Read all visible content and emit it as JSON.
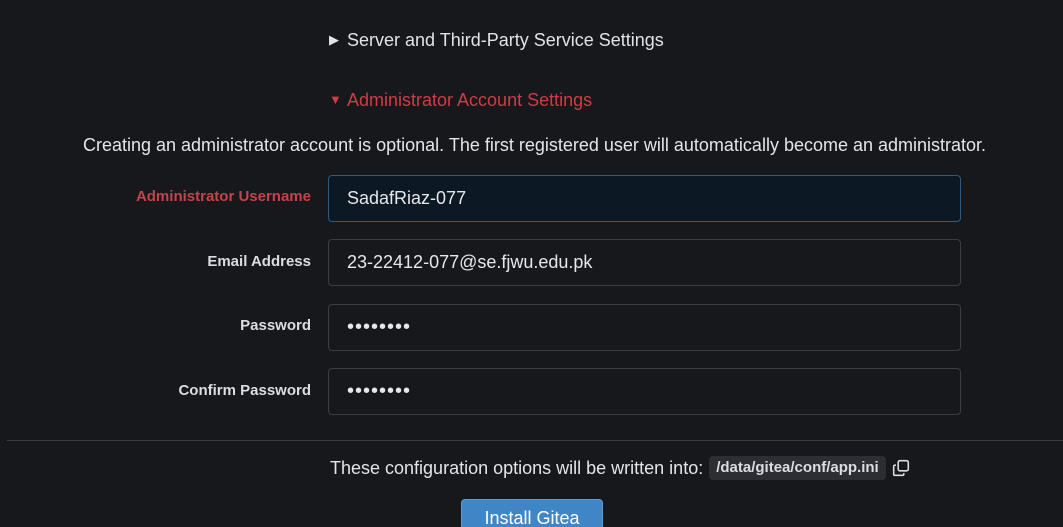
{
  "sections": {
    "server": {
      "caret": "▶",
      "label": "Server and Third-Party Service Settings",
      "expanded": false
    },
    "admin": {
      "caret": "▼",
      "label": "Administrator Account Settings",
      "expanded": true
    }
  },
  "intro_text": "Creating an administrator account is optional. The first registered user will automatically become an administrator.",
  "form": {
    "username": {
      "label": "Administrator Username",
      "value": "SadafRiaz-077"
    },
    "email": {
      "label": "Email Address",
      "value": "23-22412-077@se.fjwu.edu.pk"
    },
    "password": {
      "label": "Password",
      "value": "12345678"
    },
    "confirm_password": {
      "label": "Confirm Password",
      "value": "12345678"
    }
  },
  "config_note": {
    "text": "These configuration options will be written into:",
    "path": "/data/gitea/conf/app.ini",
    "copy_icon": "copy-icon"
  },
  "install_button": "Install Gitea",
  "colors": {
    "background": "#17181c",
    "error": "#d23b44",
    "primary": "#3f86c6",
    "focused_input_bg": "#0c1823"
  }
}
